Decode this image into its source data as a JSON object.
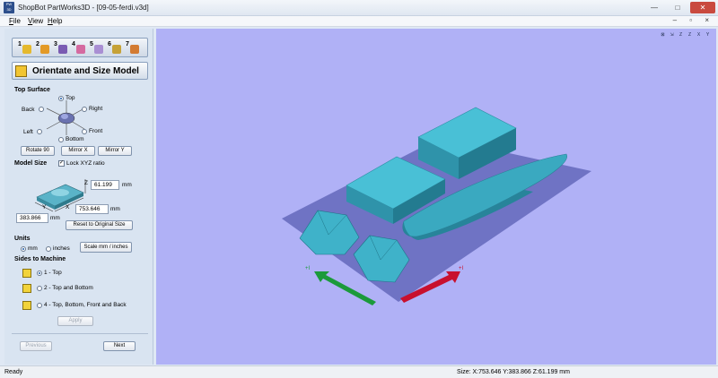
{
  "window": {
    "app_badge": "PW 3D",
    "title": "ShopBot PartWorks3D - [09-05-ferdi.v3d]",
    "minimize_glyph": "—",
    "maximize_glyph": "□",
    "close_glyph": "✕",
    "mdi_glyphs": "– ▫ ×"
  },
  "menu": {
    "file": "File",
    "view": "View",
    "help": "Help"
  },
  "steps": [
    {
      "label": "1",
      "color": "#e5b92e"
    },
    {
      "label": "2",
      "color": "#e39a27"
    },
    {
      "label": "3",
      "color": "#7a5bb2"
    },
    {
      "label": "4",
      "color": "#d56aa0"
    },
    {
      "label": "5",
      "color": "#a98fd3"
    },
    {
      "label": "6",
      "color": "#c6a237"
    },
    {
      "label": "7",
      "color": "#d37b32"
    }
  ],
  "panel": {
    "title": "Orientate and Size Model",
    "top_surface": {
      "label": "Top Surface",
      "top": "Top",
      "back": "Back",
      "right": "Right",
      "left": "Left",
      "front": "Front",
      "bottom": "Bottom",
      "rotate": "Rotate 90",
      "mirror_x": "Mirror X",
      "mirror_y": "Mirror Y"
    },
    "model_size": {
      "label": "Model Size",
      "lock_label": "Lock XYZ ratio",
      "z_value": "61.199",
      "x_value": "753.646",
      "y_value": "383.866",
      "unit": "mm",
      "reset": "Reset to Original Size",
      "axis_x": "X",
      "axis_y": "Y",
      "axis_z": "Z"
    },
    "units": {
      "label": "Units",
      "mm": "mm",
      "inches": "inches",
      "scale_button": "Scale mm / inches"
    },
    "sides": {
      "label": "Sides to Machine",
      "one": "1 - Top",
      "two": "2 - Top and Bottom",
      "four": "4 - Top, Bottom, Front and Back",
      "apply": "Apply"
    },
    "nav": {
      "previous": "Previous",
      "next": "Next"
    }
  },
  "view_tools": [
    "⊠",
    "⇲",
    "Z",
    "Z",
    "X",
    "Y"
  ],
  "viewport": {
    "background": "#b0b1f6",
    "model_color": "#37a8bf",
    "axis_x_color": "#c8102e",
    "axis_y_color": "#1b9a3a",
    "axis_x_label": "+I",
    "axis_y_label": "+I"
  },
  "status": {
    "left": "Ready",
    "size": "Size: X:753.646 Y:383.866 Z:61.199 mm"
  }
}
